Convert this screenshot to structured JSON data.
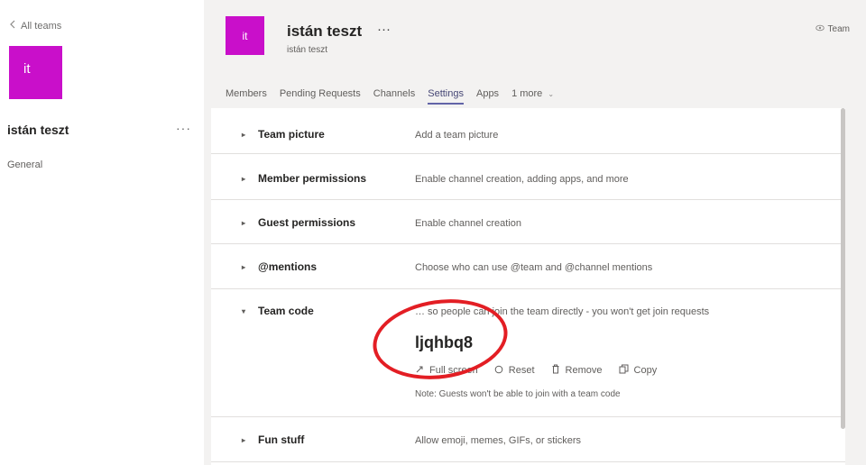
{
  "left": {
    "back_label": "All teams",
    "team_tile": "it",
    "team_name": "istán teszt",
    "more": "···",
    "channels": [
      "General"
    ]
  },
  "header": {
    "tile": "it",
    "name": "istán teszt",
    "more": "···",
    "subtitle": "istán teszt",
    "badge": "Team"
  },
  "tabs": [
    {
      "label": "Members",
      "active": false
    },
    {
      "label": "Pending Requests",
      "active": false
    },
    {
      "label": "Channels",
      "active": false
    },
    {
      "label": "Settings",
      "active": true
    },
    {
      "label": "Apps",
      "active": false
    },
    {
      "label": "1 more",
      "active": false
    }
  ],
  "settings": {
    "rows": [
      {
        "title": "Team picture",
        "description": "Add a team picture",
        "expanded": false
      },
      {
        "title": "Member permissions",
        "description": "Enable channel creation, adding apps, and more",
        "expanded": false
      },
      {
        "title": "Guest permissions",
        "description": "Enable channel creation",
        "expanded": false
      },
      {
        "title": "@mentions",
        "description": "Choose who can use @team and @channel mentions",
        "expanded": false
      },
      {
        "title": "Team code",
        "description": "… so people can join the team directly - you won't get join requests",
        "expanded": true
      },
      {
        "title": "Fun stuff",
        "description": "Allow emoji, memes, GIFs, or stickers",
        "expanded": false
      }
    ],
    "team_code": {
      "code": "ljqhbq8",
      "actions": [
        "Full screen",
        "Reset",
        "Remove",
        "Copy"
      ],
      "note": "Note: Guests won't be able to join with a team code"
    }
  },
  "colors": {
    "team_tile": "#c90fca",
    "active_tab": "#6264a7",
    "annotation_circle": "#e31e24"
  }
}
